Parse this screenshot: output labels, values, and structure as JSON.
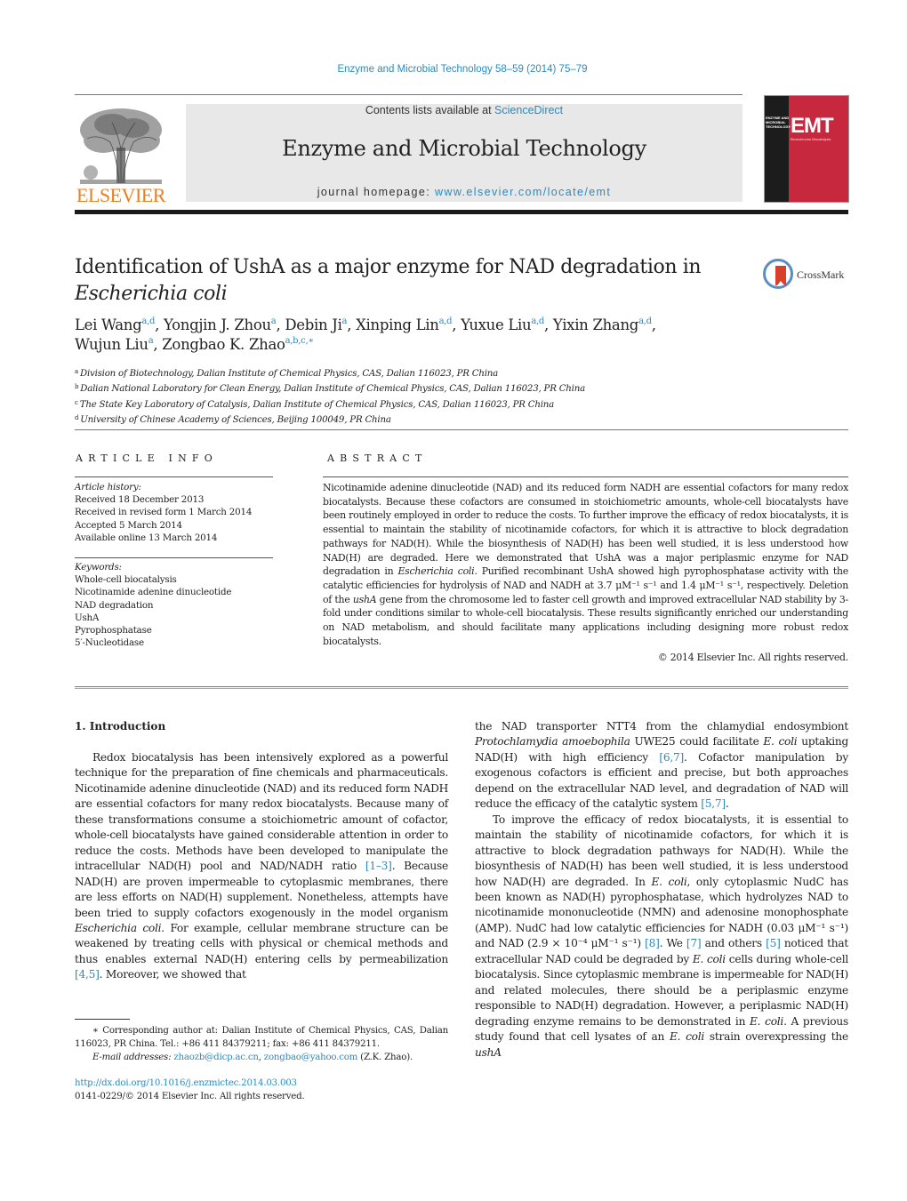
{
  "header": {
    "journal_reference": "Enzyme and Microbial Technology 58–59 (2014) 75–79",
    "contents_prefix": "Contents lists available at ",
    "contents_link": "ScienceDirect",
    "journal_title": "Enzyme and Microbial Technology",
    "homepage_prefix": "journal homepage: ",
    "homepage_link": "www.elsevier.com/locate/emt",
    "publisher_logo_text": "ELSEVIER",
    "cover": {
      "acronym": "EMT",
      "title_small": "ENZYME AND MICROBIAL TECHNOLOGY",
      "tagline": "Biomolecular Biocatalysis",
      "colors": {
        "dark": "#1c1c1c",
        "red": "#c8283d"
      }
    },
    "crossmark_label": "CrossMark"
  },
  "article": {
    "title_line1": "Identification of UshA as a major enzyme for NAD degradation in",
    "title_line2_italic": "Escherichia coli",
    "authors": [
      {
        "name": "Lei Wang",
        "sup": "a,d",
        "sep": ", "
      },
      {
        "name": "Yongjin J. Zhou",
        "sup": "a",
        "sep": ", "
      },
      {
        "name": "Debin Ji",
        "sup": "a",
        "sep": ", "
      },
      {
        "name": "Xinping Lin",
        "sup": "a,d",
        "sep": ", "
      },
      {
        "name": "Yuxue Liu",
        "sup": "a,d",
        "sep": ", "
      },
      {
        "name": "Yixin Zhang",
        "sup": "a,d",
        "sep": ","
      },
      {
        "name": "Wujun Liu",
        "sup": "a",
        "sep": ", "
      },
      {
        "name": "Zongbao K. Zhao",
        "sup": "a,b,c,∗",
        "sep": ""
      }
    ],
    "affiliations": [
      {
        "key": "a",
        "text": "Division of Biotechnology, Dalian Institute of Chemical Physics, CAS, Dalian 116023, PR China"
      },
      {
        "key": "b",
        "text": "Dalian National Laboratory for Clean Energy, Dalian Institute of Chemical Physics, CAS, Dalian 116023, PR China"
      },
      {
        "key": "c",
        "text": "The State Key Laboratory of Catalysis, Dalian Institute of Chemical Physics, CAS, Dalian 116023, PR China"
      },
      {
        "key": "d",
        "text": "University of Chinese Academy of Sciences, Beijing 100049, PR China"
      }
    ]
  },
  "article_info": {
    "heading": "ARTICLE INFO",
    "history_label": "Article history:",
    "history": [
      "Received 18 December 2013",
      "Received in revised form 1 March 2014",
      "Accepted 5 March 2014",
      "Available online 13 March 2014"
    ],
    "keywords_label": "Keywords:",
    "keywords": [
      "Whole-cell biocatalysis",
      "Nicotinamide adenine dinucleotide",
      "NAD degradation",
      "UshA",
      "Pyrophosphatase",
      "5′-Nucleotidase"
    ]
  },
  "abstract": {
    "heading": "ABSTRACT",
    "part1": "Nicotinamide adenine dinucleotide (NAD) and its reduced form NADH are essential cofactors for many redox biocatalysts. Because these cofactors are consumed in stoichiometric amounts, whole-cell biocatalysts have been routinely employed in order to reduce the costs. To further improve the efficacy of redox biocatalysts, it is essential to maintain the stability of nicotinamide cofactors, for which it is attractive to block degradation pathways for NAD(H). While the biosynthesis of NAD(H) has been well studied, it is less understood how NAD(H) are degraded. Here we demonstrated that UshA was a major periplasmic enzyme for NAD degradation in ",
    "part1_italic": "Escherichia coli",
    "part2": ". Purified recombinant UshA showed high pyrophosphatase activity with the catalytic efficiencies for hydrolysis of NAD and NADH at 3.7 μM⁻¹ s⁻¹ and 1.4 μM⁻¹ s⁻¹, respectively. Deletion of the ",
    "part2_italic": "ushA",
    "part3": " gene from the chromosome led to faster cell growth and improved extracellular NAD stability by 3-fold under conditions similar to whole-cell biocatalysis. These results significantly enriched our understanding on NAD metabolism, and should facilitate many applications including designing more robust redox biocatalysts.",
    "copyright": "© 2014 Elsevier Inc. All rights reserved."
  },
  "body": {
    "section_heading": "1.  Introduction",
    "left": {
      "s1": "Redox biocatalysis has been intensively explored as a powerful technique for the preparation of fine chemicals and pharmaceuticals. Nicotinamide adenine dinucleotide (NAD) and its reduced form NADH are essential cofactors for many redox biocatalysts. Because many of these transformations consume a stoichiometric amount of cofactor, whole-cell biocatalysts have gained considerable attention in order to reduce the costs. Methods have been developed to manipulate the intracellular NAD(H) pool and NAD/NADH ratio ",
      "ref1": "[1–3]",
      "s2": ". Because NAD(H) are proven impermeable to cytoplasmic membranes, there are less efforts on NAD(H) supplement. Nonetheless, attempts have been tried to supply cofactors exogenously in the model organism ",
      "ital1": "Escherichia coli",
      "s3": ". For example, cellular membrane structure can be weakened by treating cells with physical or chemical methods and thus enables external NAD(H) entering cells by permeabilization ",
      "ref2": "[4,5]",
      "s4": ". Moreover, we showed that"
    },
    "right": {
      "p1_a": "the NAD transporter NTT4 from the chlamydial endosymbiont ",
      "p1_ital1": "Protochlamydia amoebophila",
      "p1_b": " UWE25 could facilitate ",
      "p1_ital2": "E. coli",
      "p1_c": " uptaking NAD(H) with high efficiency ",
      "p1_ref1": "[6,7]",
      "p1_d": ". Cofactor manipulation by exogenous cofactors is efficient and precise, but both approaches depend on the extracellular NAD level, and degradation of NAD will reduce the efficacy of the catalytic system ",
      "p1_ref2": "[5,7]",
      "p1_e": ".",
      "p2_a": "To improve the efficacy of redox biocatalysts, it is essential to maintain the stability of nicotinamide cofactors, for which it is attractive to block degradation pathways for NAD(H). While the biosynthesis of NAD(H) has been well studied, it is less understood how NAD(H) are degraded. In ",
      "p2_ital1": "E. coli",
      "p2_b": ", only cytoplasmic NudC has been known as NAD(H) pyrophosphatase, which hydrolyzes NAD to nicotinamide mononucleotide (NMN) and adenosine monophosphate (AMP). NudC had low catalytic efficiencies for NADH (0.03 μM⁻¹ s⁻¹) and NAD (2.9 × 10⁻⁴ μM⁻¹ s⁻¹) ",
      "p2_ref1": "[8]",
      "p2_c": ". We ",
      "p2_ref2": "[7]",
      "p2_d": " and others ",
      "p2_ref3": "[5]",
      "p2_e": " noticed that extracellular NAD could be degraded by ",
      "p2_ital2": "E. coli",
      "p2_f": " cells during whole-cell biocatalysis. Since cytoplasmic membrane is impermeable for NAD(H) and related molecules, there should be a periplasmic enzyme responsible to NAD(H) degradation. However, a periplasmic NAD(H) degrading enzyme remains to be demonstrated in ",
      "p2_ital3": "E. coli",
      "p2_g": ". A previous study found that cell lysates of an ",
      "p2_ital4": "E. coli",
      "p2_h": " strain overexpressing the ",
      "p2_ital5": "ushA"
    }
  },
  "footnote": {
    "corresponding": "∗  Corresponding author at: Dalian Institute of Chemical Physics, CAS, Dalian 116023, PR China. Tel.: +86 411 84379211; fax: +86 411 84379211.",
    "email_label": "E-mail addresses:",
    "email1": "zhaozb@dicp.ac.cn",
    "email2": "zongbao@yahoo.com",
    "email_suffix": " (Z.K. Zhao).",
    "doi": "http://dx.doi.org/10.1016/j.enzmictec.2014.03.003",
    "issn_line": "0141-0229/© 2014 Elsevier Inc. All rights reserved."
  },
  "colors": {
    "link": "#2a8bc0",
    "elsevier_orange": "#f07d1a",
    "journal_box_bg": "#e8e8e8"
  }
}
